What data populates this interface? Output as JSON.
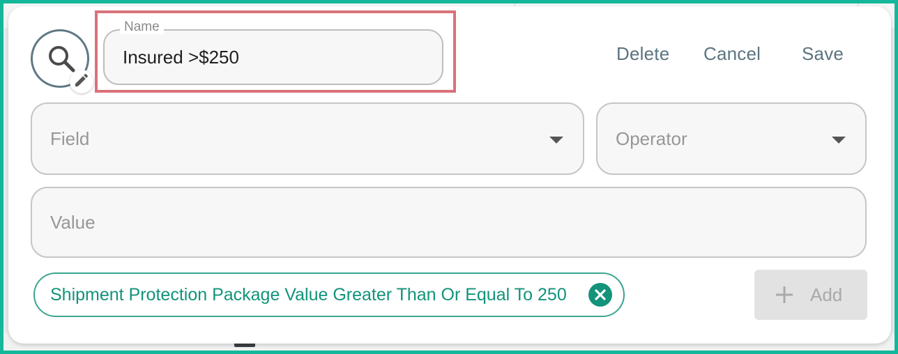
{
  "name_field": {
    "label": "Name",
    "value": "Insured >$250"
  },
  "actions": {
    "delete": "Delete",
    "cancel": "Cancel",
    "save": "Save"
  },
  "field_select": {
    "placeholder": "Field"
  },
  "operator_select": {
    "placeholder": "Operator"
  },
  "value_input": {
    "placeholder": "Value"
  },
  "chip": {
    "label": "Shipment Protection Package Value Greater Than Or Equal To 250"
  },
  "add_button": {
    "label": "Add"
  },
  "icons": {
    "avatar": "search-icon",
    "avatar_badge": "pencil-icon",
    "field_caret": "chevron-down-icon",
    "chip_remove": "close-circle-icon",
    "add": "plus-icon"
  },
  "colors": {
    "accent": "#12937a",
    "action_text": "#5b7480",
    "highlight": "#d9727b",
    "frame": "#15b79a"
  }
}
